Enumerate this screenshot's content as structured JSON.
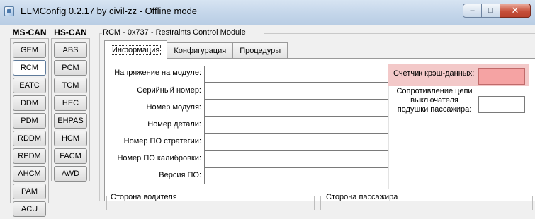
{
  "window": {
    "title": "ELMConfig 0.2.17 by civil-zz - Offline mode",
    "controls": {
      "minimize": "–",
      "maximize": "□",
      "close": "✕"
    }
  },
  "ms_can": {
    "header": "MS-CAN",
    "items": [
      "GEM",
      "RCM",
      "EATC",
      "DDM",
      "PDM",
      "RDDM",
      "RPDM",
      "AHCM",
      "PAM",
      "ACU"
    ],
    "selected": "RCM"
  },
  "hs_can": {
    "header": "HS-CAN",
    "items": [
      "ABS",
      "PCM",
      "TCM",
      "HEC",
      "EHPAS",
      "HCM",
      "FACM",
      "AWD"
    ]
  },
  "module": {
    "group_title": "RCM - 0x737 - Restraints Control Module",
    "tabs": [
      "Информация",
      "Конфигурация",
      "Процедуры"
    ],
    "active_tab": "Информация",
    "fields": [
      {
        "label": "Напряжение на модуле:",
        "value": ""
      },
      {
        "label": "Серийный номер:",
        "value": ""
      },
      {
        "label": "Номер модуля:",
        "value": ""
      },
      {
        "label": "Номер детали:",
        "value": ""
      },
      {
        "label": "Номер ПО стратегии:",
        "value": ""
      },
      {
        "label": "Номер ПО калибровки:",
        "value": ""
      },
      {
        "label": "Версия ПО:",
        "value": ""
      }
    ],
    "crash_counter": {
      "label": "Счетчик крэш-данных:",
      "value": ""
    },
    "resistance": {
      "label": "Сопротивление цепи выключателя подушки пассажира:",
      "value": ""
    },
    "driver_side": "Сторона водителя",
    "passenger_side": "Сторона пассажира"
  },
  "colors": {
    "crash_highlight": "#f3c9c9",
    "crash_field": "#f5a3a3"
  }
}
